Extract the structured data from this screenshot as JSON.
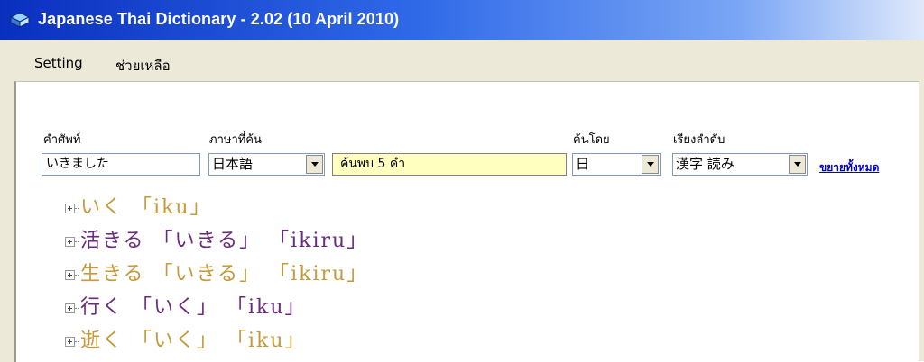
{
  "window": {
    "title": "Japanese Thai Dictionary - 2.02 (10 April 2010)"
  },
  "menu": {
    "setting": "Setting",
    "help": "ช่วยเหลือ"
  },
  "search": {
    "word_label": "คำศัพท์",
    "word_value": "いきました",
    "lang_label": "ภาษาที่ค้น",
    "lang_value": "日本語",
    "status": "ค้นพบ 5 คำ",
    "search_by_label": "ค้นโดย",
    "search_by_value": "日",
    "sort_label": "เรียงลำดับ",
    "sort_value": "漢字 読み",
    "expand_all": "ขยายทั้งหมด"
  },
  "colors": {
    "gold": "#c49a3a",
    "purple": "#6b2a80"
  },
  "results": [
    {
      "text": "いく 「iku」",
      "color": "gold"
    },
    {
      "text": "活きる 「いきる」 「ikiru」",
      "color": "purple"
    },
    {
      "text": "生きる 「いきる」 「ikiru」",
      "color": "gold"
    },
    {
      "text": "行く 「いく」 「iku」",
      "color": "purple"
    },
    {
      "text": "逝く 「いく」 「iku」",
      "color": "gold"
    }
  ]
}
